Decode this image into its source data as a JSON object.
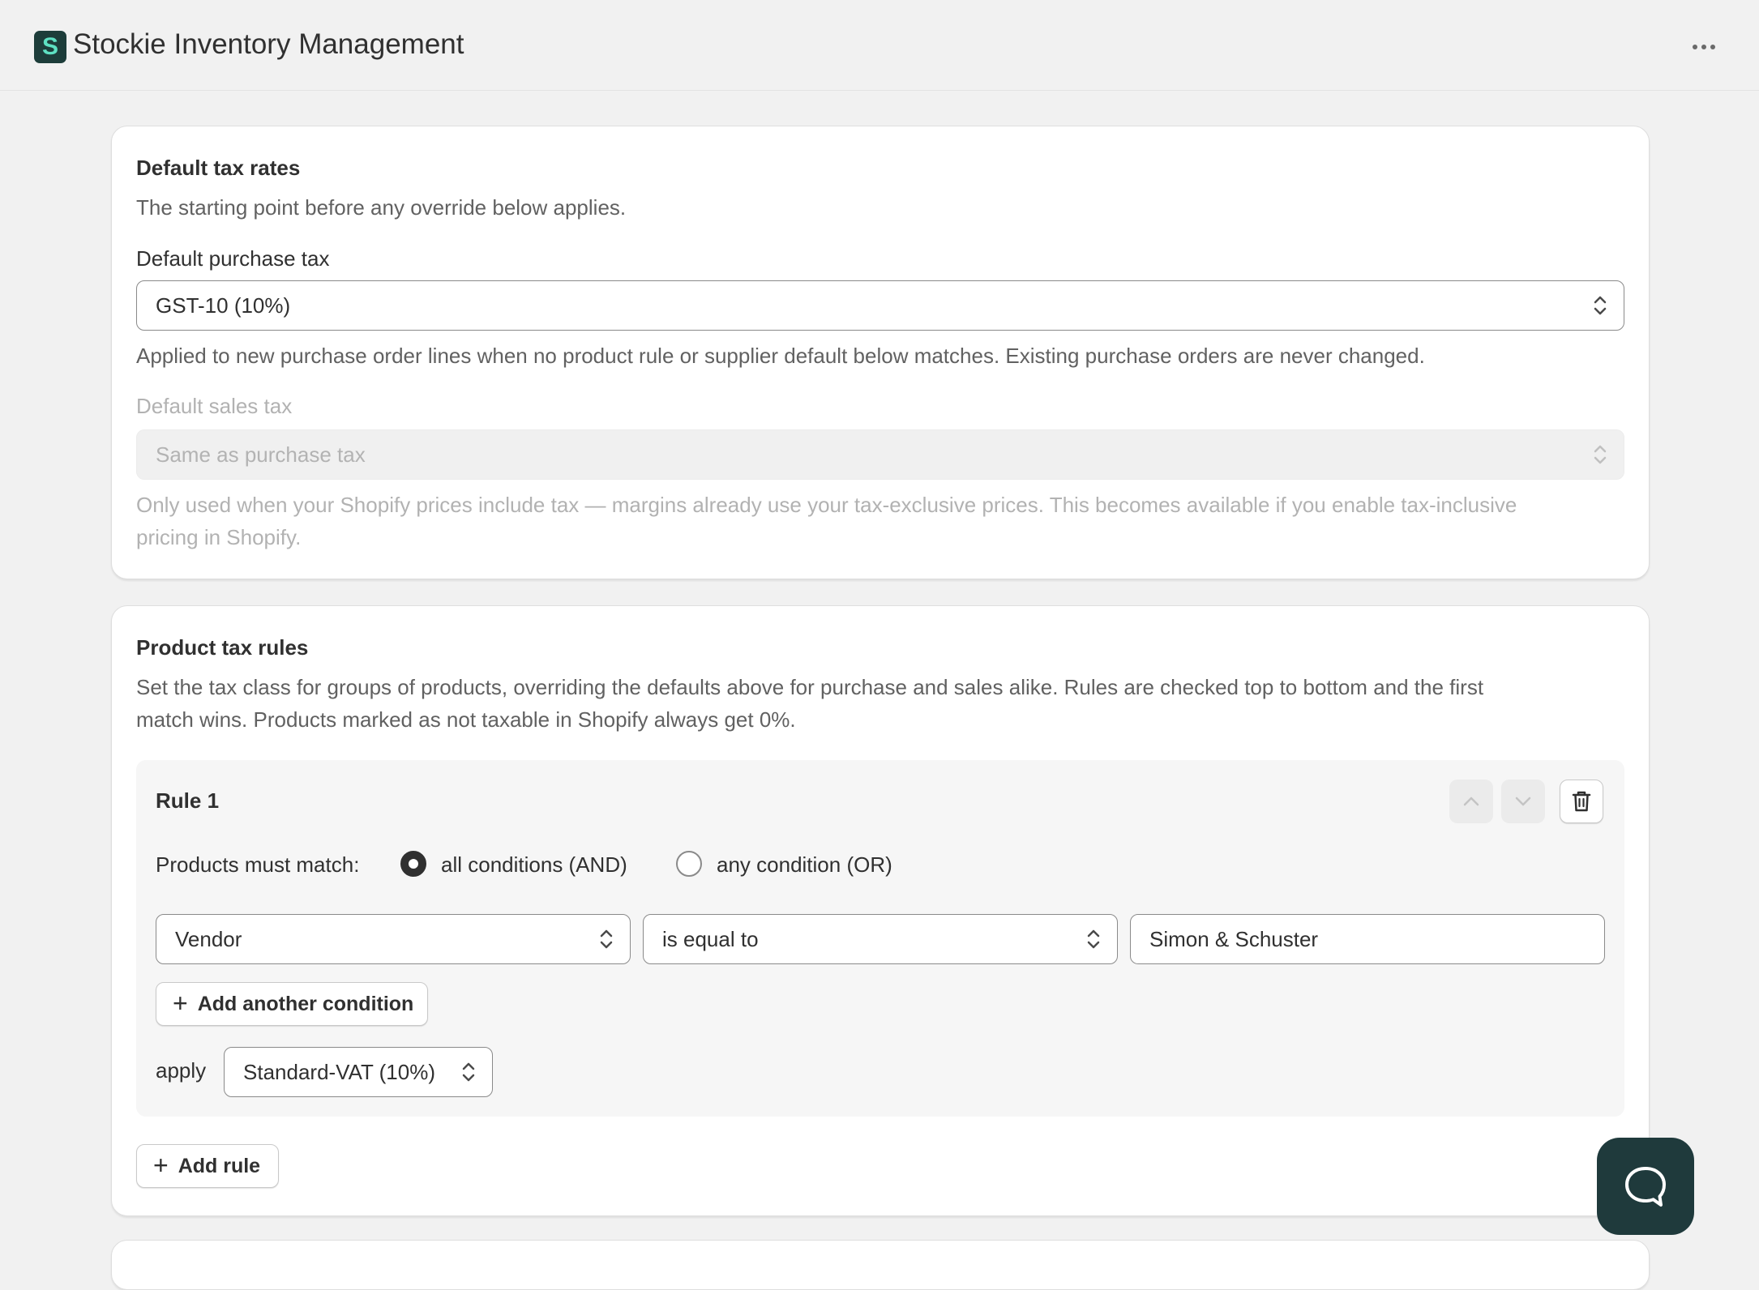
{
  "header": {
    "app_title": "Stockie Inventory Management",
    "logo_letter": "S",
    "menu_icon": "more-horizontal-icon"
  },
  "default_tax": {
    "title": "Default tax rates",
    "subtitle": "The starting point before any override below applies.",
    "purchase_label": "Default purchase tax",
    "purchase_value": "GST-10 (10%)",
    "purchase_help": "Applied to new purchase order lines when no product rule or supplier default below matches. Existing purchase orders are never changed.",
    "sales_label": "Default sales tax",
    "sales_value": "Same as purchase tax",
    "sales_help_line1": "Only used when your Shopify prices include tax — margins already use your tax-exclusive prices. This becomes available if you enable tax-inclusive",
    "sales_help_line2": "pricing in Shopify."
  },
  "product_rules": {
    "title": "Product tax rules",
    "description_line1": "Set the tax class for groups of products, overriding the defaults above for purchase and sales alike. Rules are checked top to bottom and the first",
    "description_line2": "match wins. Products marked as not taxable in Shopify always get 0%.",
    "rules": [
      {
        "title": "Rule 1",
        "match_label": "Products must match:",
        "match_all_label": "all conditions (AND)",
        "match_any_label": "any condition (OR)",
        "selected_match": "all",
        "condition": {
          "field": "Vendor",
          "operator": "is equal to",
          "value": "Simon & Schuster"
        },
        "add_condition_label": "Add another condition",
        "apply_label": "apply",
        "apply_value": "Standard-VAT (10%)"
      }
    ],
    "add_rule_label": "Add rule"
  },
  "colors": {
    "background": "#f1f1f1",
    "card": "#ffffff",
    "brand_dark": "#1f3a3c",
    "brand_accent": "#5ee0c2",
    "text": "#303030",
    "muted_text": "#616161"
  }
}
